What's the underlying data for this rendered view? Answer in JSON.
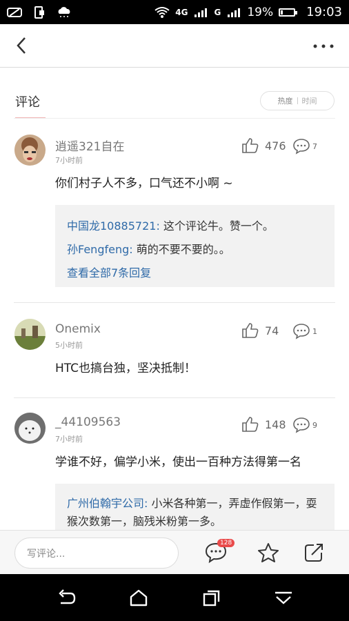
{
  "status_bar": {
    "network_label": "4G",
    "signal2_label": "G",
    "battery_percent": "19%",
    "battery_level": 0.19,
    "time": "19:03"
  },
  "header": {
    "tab_label": "评论",
    "sort_options": [
      "热度",
      "时间"
    ]
  },
  "comments": [
    {
      "username": "逍遥321自在",
      "time": "7小时前",
      "text": "你们村子人不多，口气还不小啊 ~",
      "likes": "476",
      "reply_count": "7",
      "replies": [
        {
          "name": "中国龙10885721:",
          "text": " 这个评论牛。赞一个。"
        },
        {
          "name": "孙Fengfeng:",
          "text": " 萌的不要不要的。。"
        }
      ],
      "view_all": "查看全部7条回复"
    },
    {
      "username": "Onemix",
      "time": "5小时前",
      "text": "HTC也搞台独，坚决抵制！",
      "likes": "74",
      "reply_count": "1"
    },
    {
      "username": "_44109563",
      "time": "7小时前",
      "text": "学谁不好，偏学小米，使出一百种方法得第一名",
      "likes": "148",
      "reply_count": "9",
      "replies": [
        {
          "name": "广州伯翰宇公司:",
          "text": " 小米各种第一，弄虚作假第一，耍猴次数第一，脑残米粉第一多。"
        }
      ]
    }
  ],
  "bottom_bar": {
    "input_placeholder": "写评论...",
    "comment_badge": "128"
  },
  "colors": {
    "link_blue": "#2f6aa8",
    "badge_red": "#e94b4b",
    "tab_underline": "#f0b4b4"
  },
  "icons": [
    "back-icon",
    "more-icon",
    "like-icon",
    "reply-icon",
    "comment-icon",
    "star-icon",
    "share-icon",
    "nav-back-icon",
    "nav-home-icon",
    "nav-recent-icon",
    "nav-hide-icon"
  ]
}
